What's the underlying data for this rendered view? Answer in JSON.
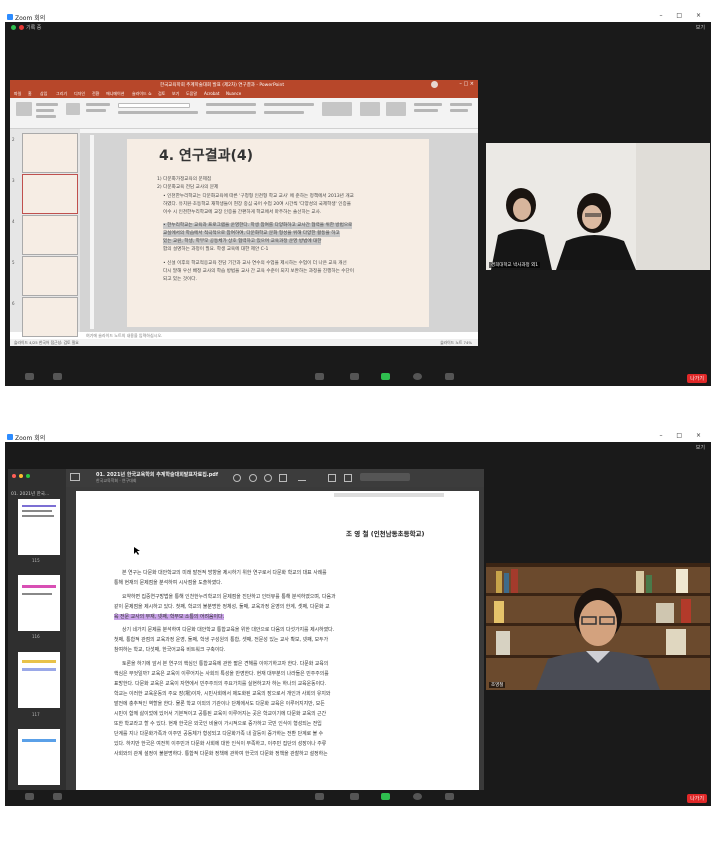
{
  "top_zoom": {
    "window_title": "Zoom 회의",
    "rec_label": "기록 중",
    "view_label": "보기",
    "ppt_title": "한국교육학회 추계학술대회 발표 (제2차) 연구결과 - PowerPoint",
    "ppt_tabs": [
      "파일",
      "홈",
      "삽입",
      "그리기",
      "디자인",
      "전환",
      "애니메이션",
      "슬라이드 쇼",
      "검토",
      "보기",
      "도움말",
      "Acrobat",
      "Nuance"
    ],
    "slide_title": "4. 연구결과(4)",
    "slide_lines": [
      "1) 다문화가정교육의 문제점",
      "2) 다문화교육 전담 교사의 문제",
      "• 인천한누리학교는 다문화교육에 따른 '구청형 인천형 학교 교사' 에 준하는 정책에서 2013년 개교",
      "  하였다. 유치원·초등학교 재학생들이 현장 중심 국어 수업 20여 시간씩 '다양성의 국제학생' 인증을",
      "  이수 시 인천한누리학교에 교장 인증을 간편하게 학교에서 마주하는 솔선하는 교사.",
      "• 한누리학교는 교육과 프로그램을 운영한다. 학생 참여를 다양화하고 교사간 협력을 위한 방법으로",
      "  교실에서의 학습에서 적극적으로 참여하여, 다문화학교 문화 형성을 위해 다양한 활동을 하고",
      "  있는 교원, 학생, 학부모 공동체가 상호 협력하고 있으며 교육과정 운영 방법에 대한",
      "  합의 설명하는 과정이 필요. 학생 교육에 대한 제안 C-1",
      "• 신설 이후의 학교적응교육 전담 기간과 교사 연수의 수업을 제시하는 수업이 더 나은 교육 개선",
      "  다시 말해 우선 배정 교사의 학습 방법을 교사 간 교육 수준이 되지 보완하는 과정을 진행하는 수단이",
      "  되고 있는 것이다."
    ],
    "notes_placeholder": "여기에 슬라이드 노트의 내용을 입력하십시오.",
    "status_left": "슬라이드 4/25   한국어   접근성: 검토 필요",
    "status_right": "슬라이드 노트   74%",
    "thumb_nums": [
      "2",
      "3",
      "4",
      "5",
      "6"
    ],
    "video_name": "경희대학교 박사과정 외1"
  },
  "bottom_zoom": {
    "window_title": "Zoom 회의",
    "view_label": "보기",
    "pdf_filename": "01. 2021년 한국교육학회 추계학술대회발표자료집.pdf",
    "pdf_subtitle": "한국교육학회 · 연구대회",
    "sidebar_title": "01. 2021년 한국...",
    "page_numbers": [
      "115",
      "116",
      "117"
    ],
    "author": "조 영 철 (인천남동초등학교)",
    "pdf_lines": [
      "본 연구는 다문화 대안학교의 미래 발전적 방향을 제시하기 위한 연구로서 다문화 학교의 대표 사례를",
      "통해 현재의 문제점을 분석하여 시사점을 도출하였다.",
      "요약하면 집중연구방법을 통해 인천한누리학교의 문제점을 진단하고 인터뷰를 통해 분석하였으며, 다음과",
      "같이 문제점을 제시하고 있다. 첫째, 학교의 불분명한 정체성, 둘째, 교육과정 운영의 한계, 셋째, 다문화 교",
      "육 전문 교사의 부재, 넷째, 학부모 소통의 어려움이다.",
      "상기 네가지 문제를 분석하여 다문화 대안학교 통합교육을 위한 대안으로 다음의 다섯가지를 제시하였다.",
      "첫째, 통합적 관점의 교육과정 운영, 둘째, 학생 구성원의 통합, 셋째, 전문성 있는 교사 확보, 넷째, 모두가",
      "참여하는 학교, 다섯째, 한국어교육 비트워크 구축이다.",
      "토론을 하기에 앞서 본 연구의 핵심인 통합교육에 관한 짧은 견해를 이야기하고자 한다. 다문화 교육의",
      "핵심은 무엇일까? 교육은 교육이 이루어지는 사회의 특성을 반영한다. 현재 대부분의 나라들은 민주주의를",
      "표방한다. 다문화 교육은 교육이 자연에서 민주주의의 주요가치를 실현하고자 하는 하나의 교육운동이다.",
      "학교는 이러한 교육운동의 주요 장(場)이자, 시민사회에서 제도화된 교육의 장으로서 개인과 사회의 유지와",
      "발전에 충추적인 역할을 한다. 물론 학교 이외의 기관이나 단체에서도 다문화 교육은 이루어지지만, 모든",
      "시민이 함께 삶이었에 있어서 기본적이고 공통된 교육이 이루어지는 곳은 학교이기에 다문화 교육의 근간",
      "또한 학교라고 할 수 있다. 현재 한국은 외국인 비율이 가시적으로 증가하고 국민 인식이 형성되는 전입",
      "단계를 지나 다문화가족과 이주민 공동체가 형성되고 다문화가족 내 갈등이 증가하는 전환 단계로 볼 수",
      "있다. 하지만 한국은 여전히 이주민과 다문화 사회에 대한 인식이 부족하고, 이주민 집단의 성장이나 주류",
      "사회와의 관계 설정이 불분명하다. 통합적 다문화 정책에 관하여 한국의 다문화 정책을 관찰하고 설정하는"
    ],
    "video_name": "조영철"
  },
  "colors": {
    "ppt_accent": "#b7472a",
    "zoom_end": "#e02828",
    "highlight": "#c9a3e8"
  }
}
